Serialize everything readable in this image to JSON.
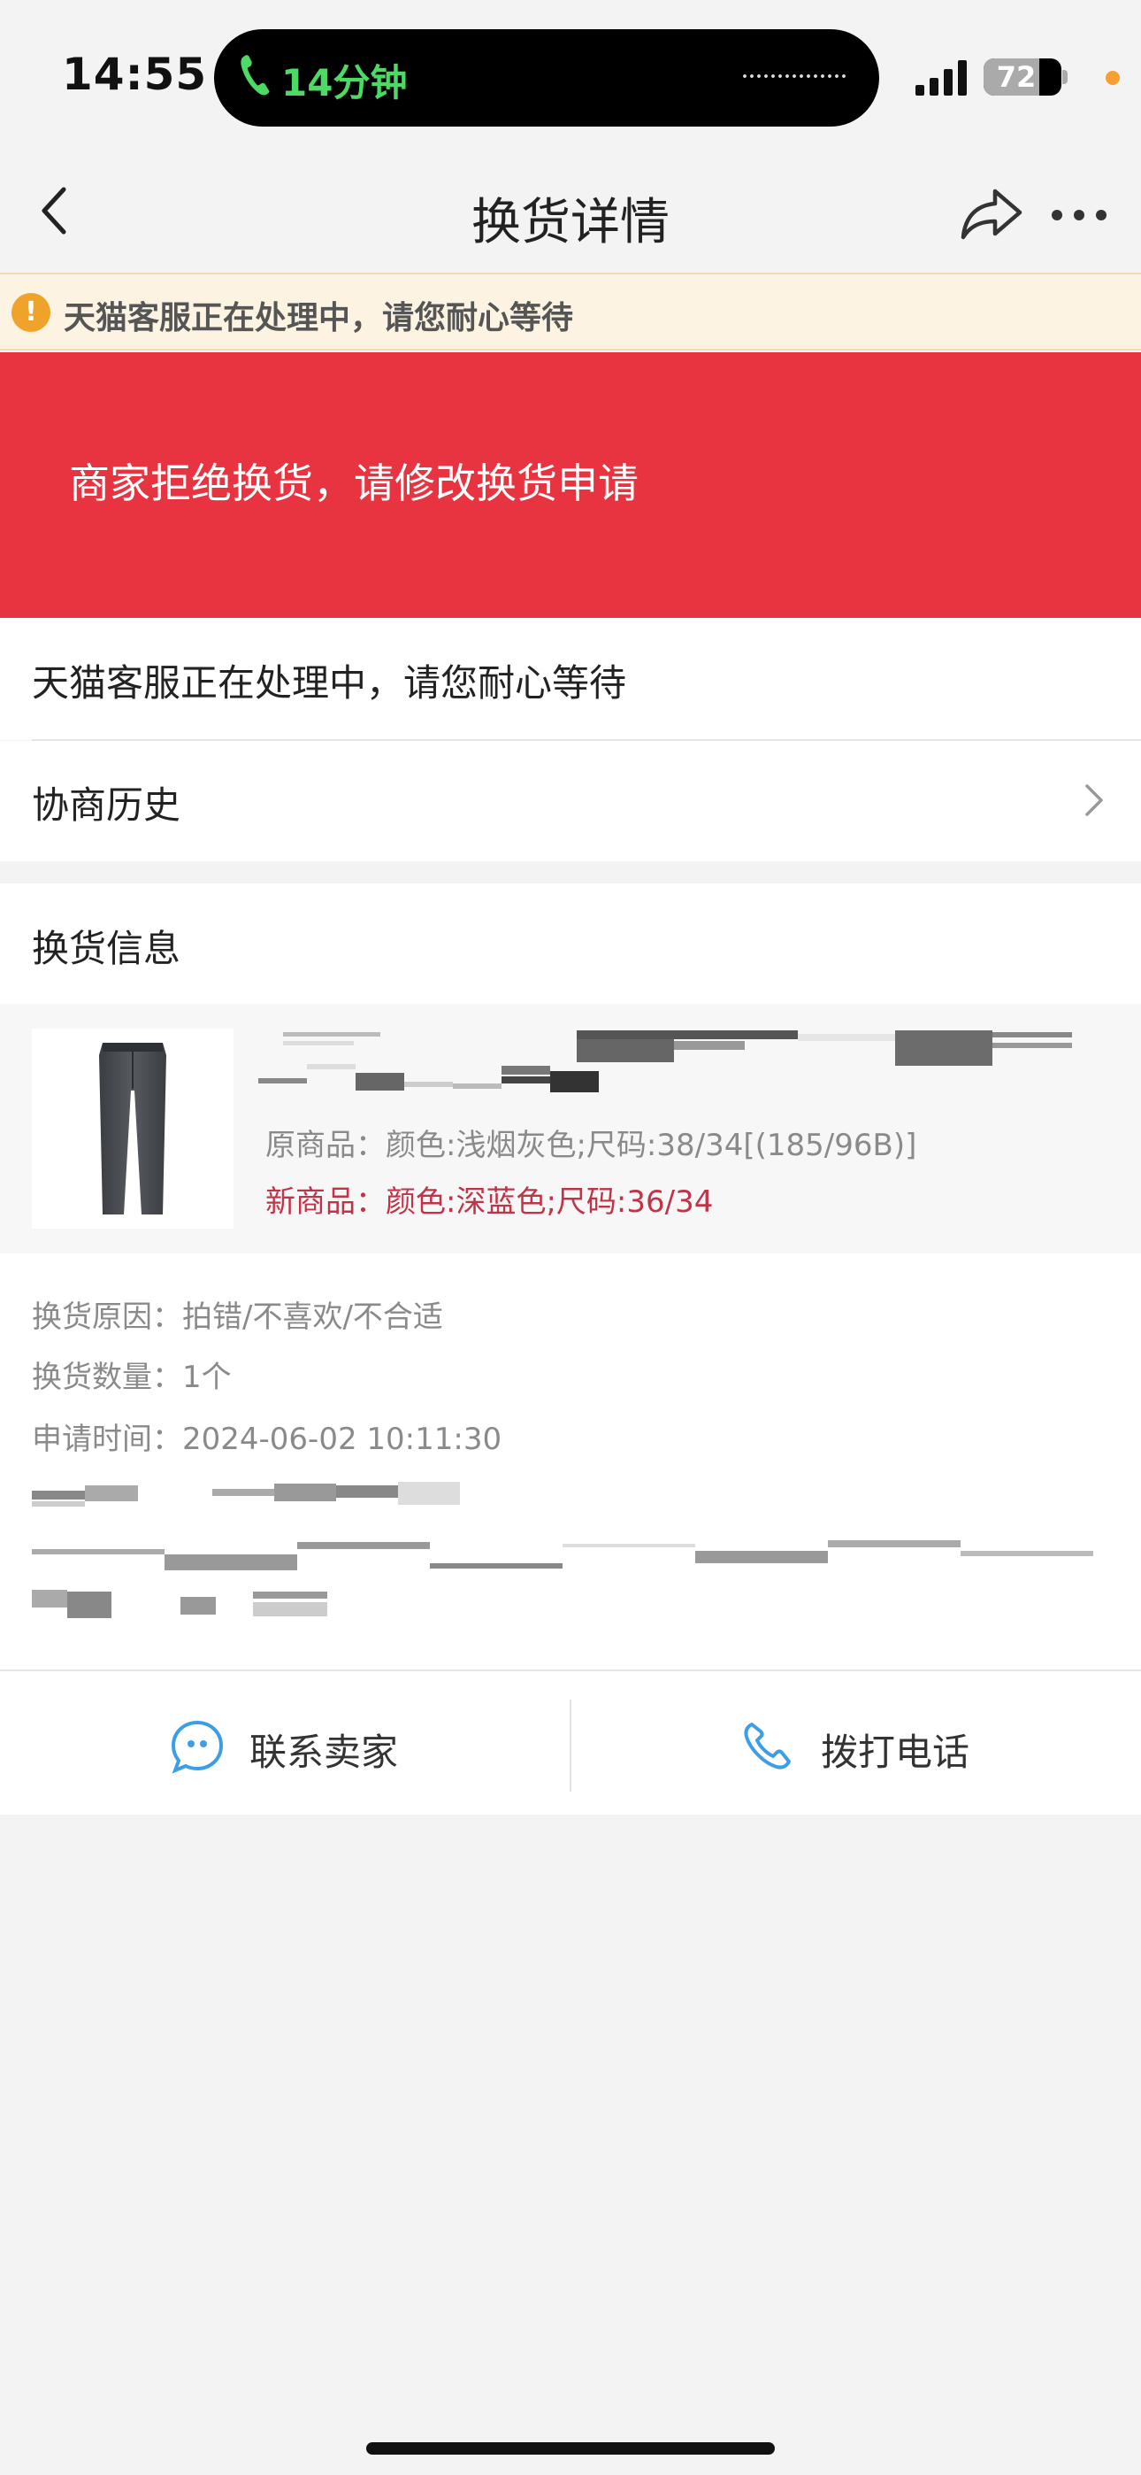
{
  "status_bar": {
    "time": "14:55",
    "call_duration": "14分钟",
    "battery_level": "72",
    "battery_fraction": 0.72
  },
  "nav": {
    "title": "换货详情"
  },
  "notice": {
    "warning_text": "天猫客服正在处理中，请您耐心等待"
  },
  "banner": {
    "text": "商家拒绝换货，请修改换货申请"
  },
  "rows": {
    "status_text": "天猫客服正在处理中，请您耐心等待",
    "history_label": "协商历史"
  },
  "exchange_info": {
    "header": "换货信息",
    "original_item": "原商品：颜色:浅烟灰色;尺码:38/34[(185/96B)]",
    "new_item": "新商品：颜色:深蓝色;尺码:36/34",
    "reason": "换货原因：拍错/不喜欢/不合适",
    "quantity": "换货数量：1个",
    "apply_time": "申请时间：2024-06-02 10:11:30"
  },
  "actions": {
    "contact_seller": "联系卖家",
    "call_phone": "拨打电话"
  },
  "colors": {
    "banner_red": "#e83440",
    "new_item_red": "#c0344a",
    "warning_orange": "#f0a32a",
    "icon_blue": "#3d9ee8",
    "call_green": "#4cd964"
  },
  "icons": {
    "back": "chevron-left-icon",
    "share": "share-arrow-icon",
    "more": "more-dots-icon",
    "warning": "exclamation-circle-icon",
    "chevron": "chevron-right-icon",
    "contact": "chat-bubble-icon",
    "phone": "phone-icon"
  }
}
